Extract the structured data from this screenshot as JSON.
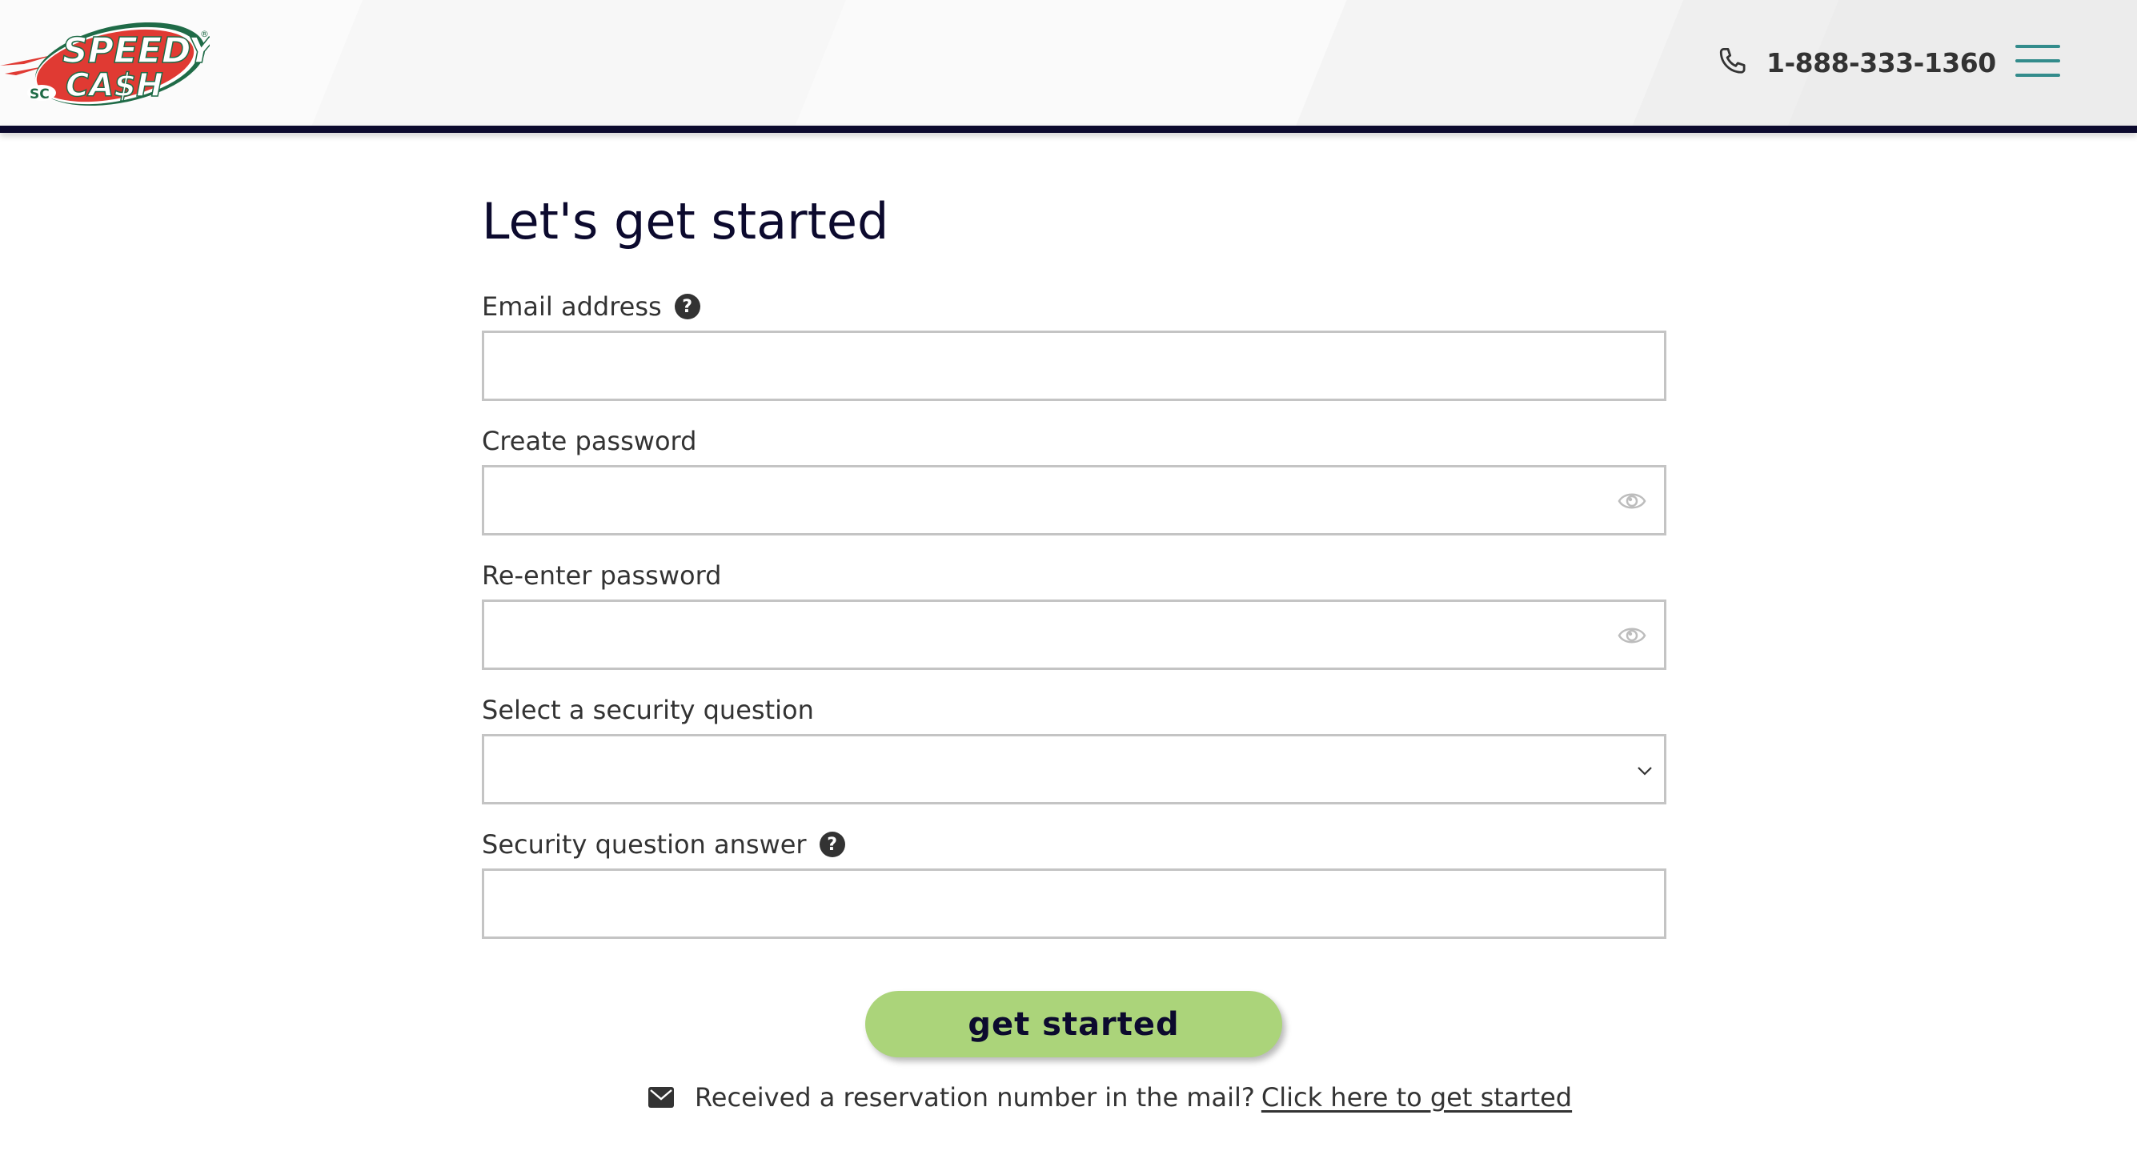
{
  "header": {
    "logo": {
      "top_text": "SPEEDY",
      "bottom_text": "CA$H",
      "badge": "SC",
      "registered": "®"
    },
    "phone_icon": "phone-icon",
    "phone_number": "1-888-333-1360",
    "menu_icon": "hamburger-menu-icon"
  },
  "form": {
    "title": "Let's get started",
    "fields": [
      {
        "label": "Email address",
        "type": "email",
        "value": "",
        "placeholder": "",
        "has_help": true
      },
      {
        "label": "Create password",
        "type": "password",
        "value": "",
        "placeholder": "",
        "has_eye_toggle": true
      },
      {
        "label": "Re-enter password",
        "type": "password",
        "value": "",
        "placeholder": "",
        "has_eye_toggle": true
      },
      {
        "label": "Select a security question",
        "type": "select",
        "selected": ""
      },
      {
        "label": "Security question answer",
        "type": "text",
        "value": "",
        "placeholder": "",
        "has_help": true
      }
    ],
    "help_glyph": "?",
    "submit_label": "get started"
  },
  "footer": {
    "mail_icon": "envelope-icon",
    "text": "Received a reservation number in the mail?",
    "link_text": "Click here to get started"
  },
  "colors": {
    "brand_navy": "#0c0a2e",
    "button_green": "#abd47a",
    "menu_teal": "#338c8c",
    "logo_red": "#e03a33",
    "logo_green": "#1f6b47"
  }
}
